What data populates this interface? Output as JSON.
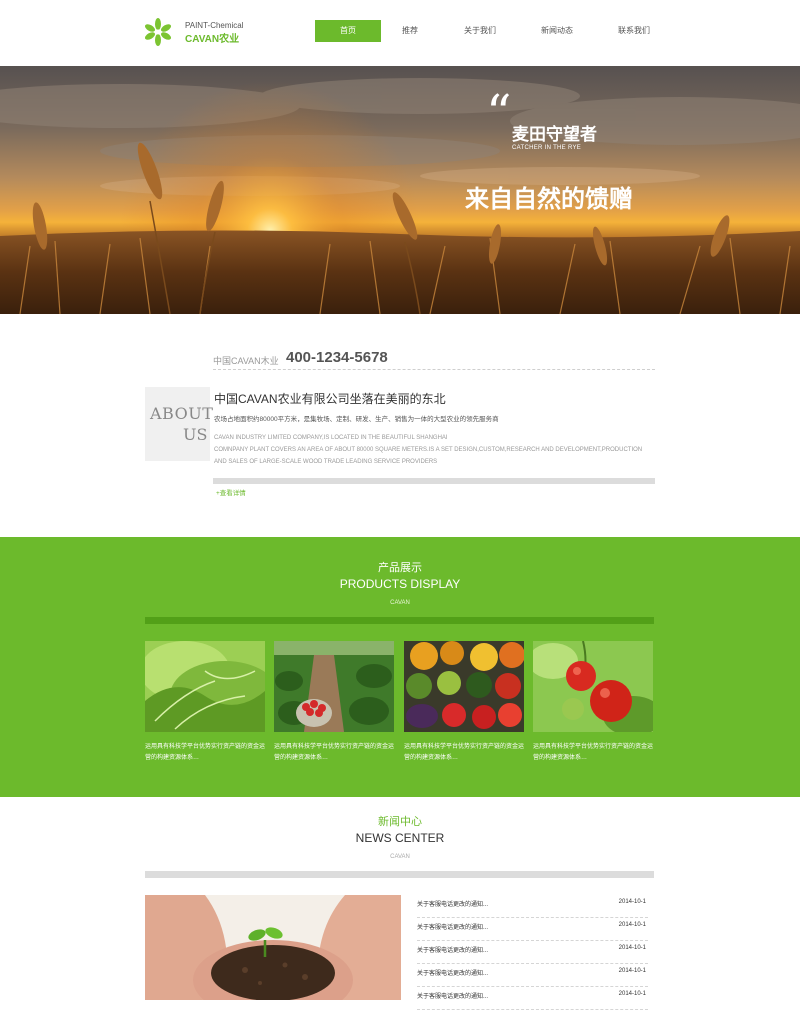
{
  "brand": {
    "top": "PAINT-Chemical",
    "bottom": "CAVAN农业",
    "accent_color": "#6cba2c"
  },
  "nav": {
    "items": [
      {
        "label": "首页",
        "active": true
      },
      {
        "label": "推荐",
        "active": false
      },
      {
        "label": "关于我们",
        "active": false
      },
      {
        "label": "新闻动态",
        "active": false
      },
      {
        "label": "联系我们",
        "active": false
      }
    ]
  },
  "banner": {
    "quote": "“",
    "title": "麦田守望者",
    "subtitle": "CATCHER IN THE RYE",
    "slogan": "来自自然的馈赠"
  },
  "about": {
    "phone_label": "中国CAVAN木业",
    "phone": "400-1234-5678",
    "badge_line1": "ABOUT",
    "badge_line2": "US",
    "title": "中国CAVAN农业有限公司坐落在美丽的东北",
    "desc_cn": "农场占地面积约80000平方米，是集牧场、定制、研发、生产、销售为一体的大型农业的领先服务商",
    "desc_en_1": "CAVAN INDUSTRY LIMITED COMPANY,IS LOCATED IN THE BEAUTIFUL SHANGHAI",
    "desc_en_2": "COMNPANY PLANT COVERS AN AREA OF ABOUT 80000 SQUARE METERS.IS A SET DESIGN,CUSTOM,RESEARCH AND DEVELOPMENT,PRODUCTION",
    "desc_en_3": "AND SALES OF LARGE-SCALE WOOD TRADE LEADING SERVICE PROVIDERS",
    "more": "+查看详情"
  },
  "products": {
    "title_cn": "产品展示",
    "title_en": "PRODUCTS DISPLAY",
    "sub": "CAVAN",
    "items": [
      {
        "image": "lettuce",
        "text": "运用具有科技学平台优势实行资产链的资金运营的构建资源体系…"
      },
      {
        "image": "strawberry-field",
        "text": "运用具有科技学平台优势实行资产链的资金运营的构建资源体系…"
      },
      {
        "image": "vegetables",
        "text": "运用具有科技学平台优势实行资产链的资金运营的构建资源体系…"
      },
      {
        "image": "tomatoes",
        "text": "运用具有科技学平台优势实行资产链的资金运营的构建资源体系…"
      }
    ]
  },
  "news": {
    "title_cn": "新闻中心",
    "title_en": "NEWS CENTER",
    "sub": "CAVAN",
    "image": "seedling-in-hands",
    "items": [
      {
        "title": "关于客服电话更改的通知...",
        "date": "2014-10-1"
      },
      {
        "title": "关于客服电话更改的通知...",
        "date": "2014-10-1"
      },
      {
        "title": "关于客服电话更改的通知...",
        "date": "2014-10-1"
      },
      {
        "title": "关于客服电话更改的通知...",
        "date": "2014-10-1"
      },
      {
        "title": "关于客服电话更改的通知...",
        "date": "2014-10-1"
      }
    ]
  }
}
